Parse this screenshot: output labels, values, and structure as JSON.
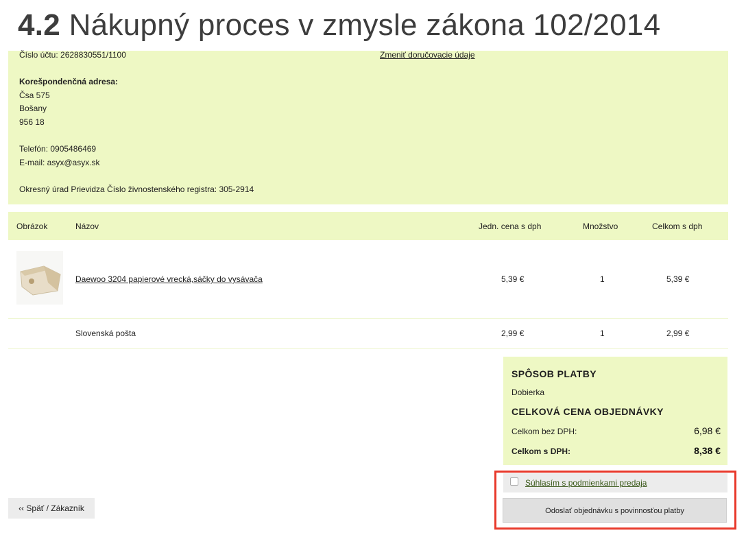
{
  "slide": {
    "title_number": "4.2",
    "title_text": "Nákupný proces v zmysle zákona 102/2014"
  },
  "seller": {
    "account_line": "Číslo účtu: 2628830551/1100",
    "change_delivery_link": "Zmeniť doručovacie údaje",
    "address_heading": "Korešpondenčná adresa:",
    "address_lines": [
      "Čsa 575",
      "Bošany",
      "956 18"
    ],
    "phone": "Telefón: 0905486469",
    "email": "E-mail: asyx@asyx.sk",
    "registry": "Okresný úrad Prievidza Číslo živnostenského registra: 305-2914"
  },
  "table": {
    "headers": {
      "image": "Obrázok",
      "name": "Názov",
      "unit_price": "Jedn. cena s dph",
      "quantity": "Množstvo",
      "total": "Celkom s dph"
    },
    "rows": [
      {
        "name": "Daewoo 3204 papierové vrecká,sáčky do vysávača",
        "unit_price": "5,39 €",
        "quantity": "1",
        "total": "5,39 €"
      },
      {
        "name": "Slovenská pošta",
        "unit_price": "2,99 €",
        "quantity": "1",
        "total": "2,99 €"
      }
    ]
  },
  "summary": {
    "payment_heading": "SPÔSOB PLATBY",
    "payment_method": "Dobierka",
    "total_heading": "CELKOVÁ CENA OBJEDNÁVKY",
    "without_vat_label": "Celkom bez DPH:",
    "without_vat_value": "6,98 €",
    "with_vat_label": "Celkom s DPH:",
    "with_vat_value": "8,38 €"
  },
  "actions": {
    "agree_label": "Súhlasím s podmienkami predaja",
    "agree_checked": false,
    "submit_label": "Odoslať objednávku s povinnosťou platby",
    "back_label": "‹‹ Späť / Zákazník"
  },
  "colors": {
    "panel_bg": "#eef8c4",
    "highlight": "#e8392b",
    "link": "#3b5a1a"
  }
}
